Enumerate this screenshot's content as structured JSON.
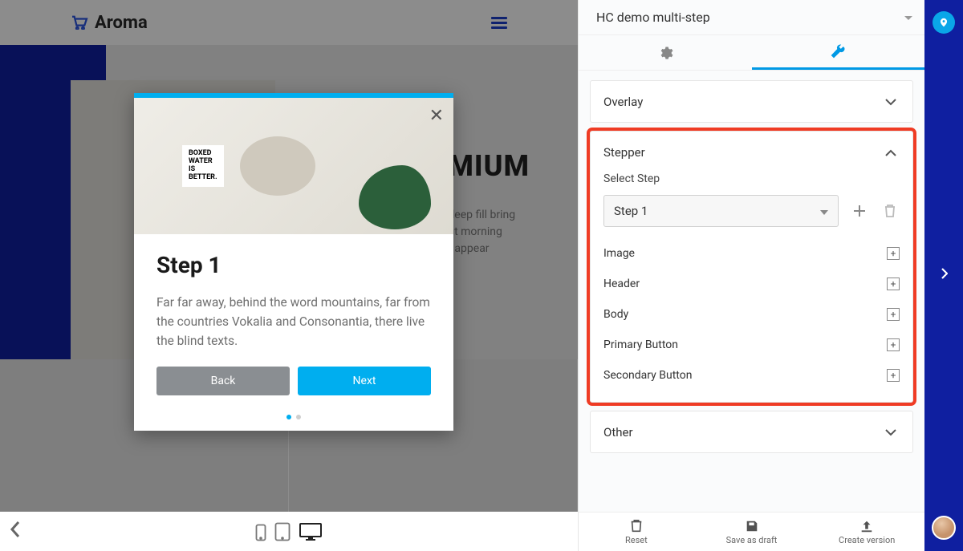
{
  "site": {
    "brand": "Aroma",
    "hero_title": "MIUM",
    "hero_sub": "deep fill bring\nut morning\nt appear"
  },
  "modal": {
    "title": "Step 1",
    "body": "Far far away, behind the word mountains, far from the countries Vokalia and Consonantia, there live the blind texts.",
    "back": "Back",
    "next": "Next",
    "boxed": "BOXED\nWATER\nIS\nBETTER."
  },
  "editor": {
    "title": "HC demo multi-step",
    "sections": {
      "overlay": "Overlay",
      "stepper": "Stepper",
      "other": "Other"
    },
    "stepper": {
      "select_label": "Select Step",
      "selected": "Step 1",
      "items": [
        "Image",
        "Header",
        "Body",
        "Primary Button",
        "Secondary Button"
      ]
    },
    "footer": {
      "reset": "Reset",
      "save": "Save as draft",
      "create": "Create version"
    }
  }
}
